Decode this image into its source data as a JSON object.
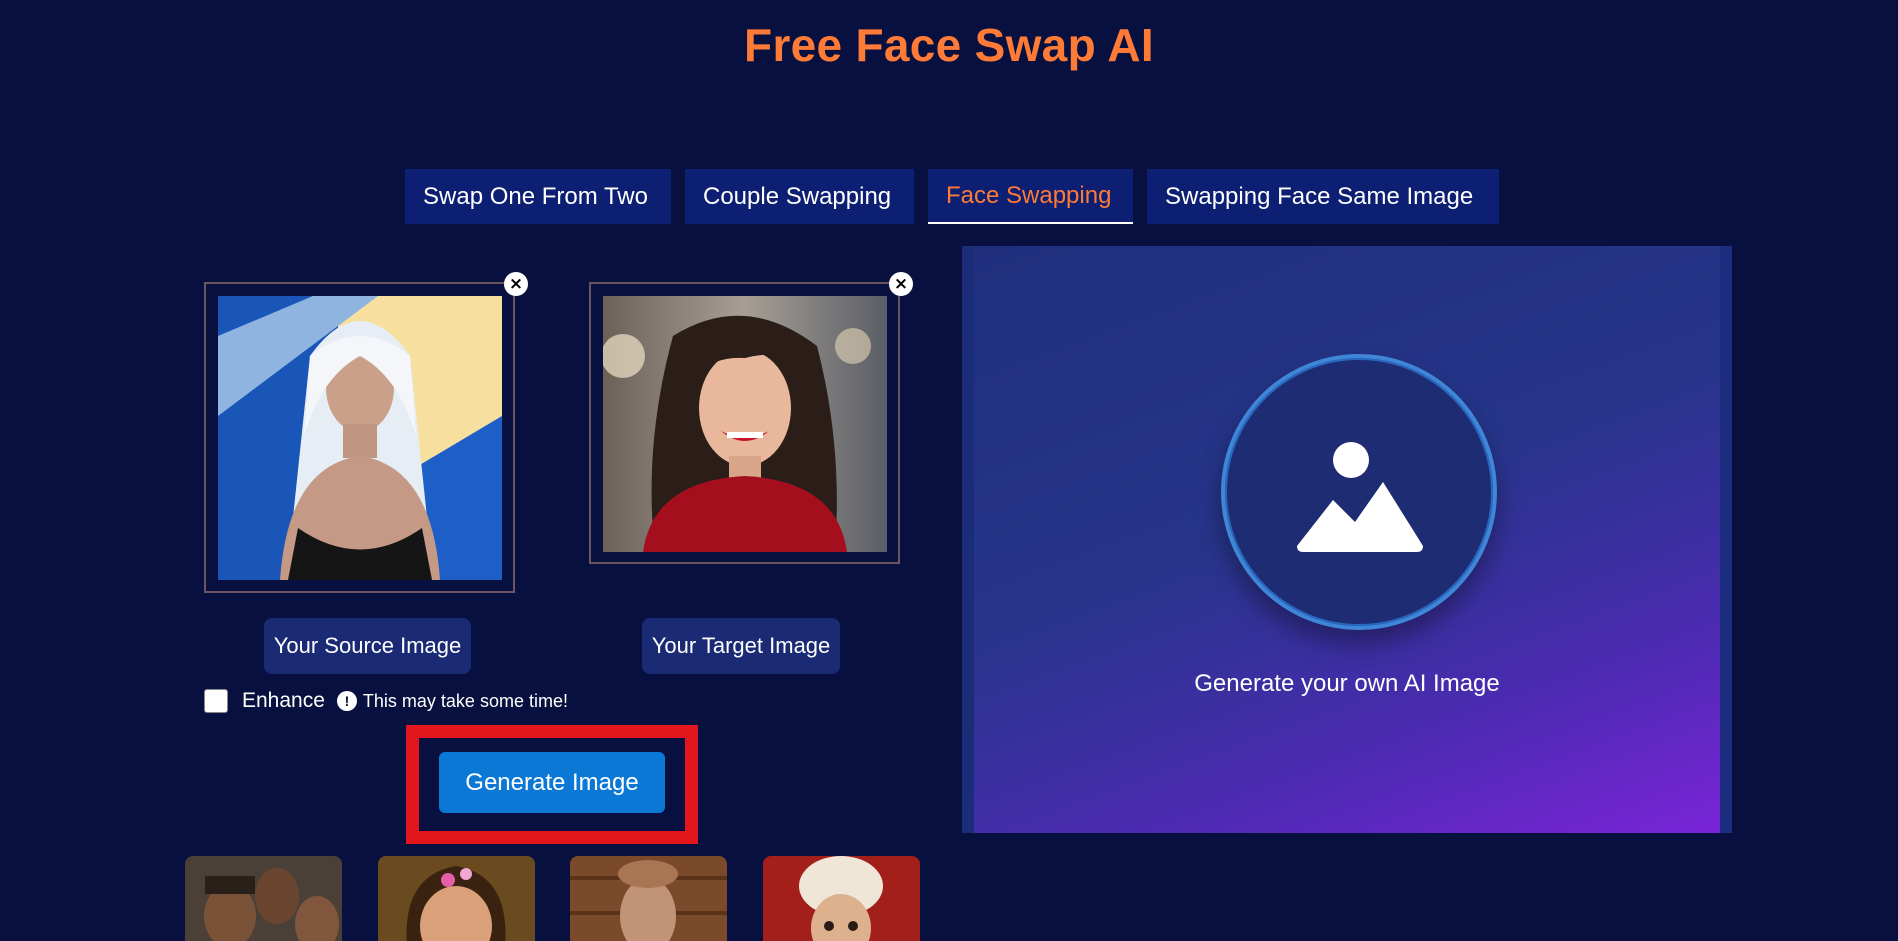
{
  "header": {
    "title": "Free Face Swap AI"
  },
  "tabs": [
    {
      "label": "Swap One From Two"
    },
    {
      "label": "Couple Swapping"
    },
    {
      "label": "Face Swapping",
      "active": true
    },
    {
      "label": "Swapping Face Same Image"
    }
  ],
  "source": {
    "label": "Your Source Image",
    "close_icon": "×"
  },
  "target": {
    "label": "Your Target Image",
    "close_icon": "×"
  },
  "options": {
    "enhance_label": "Enhance",
    "enhance_checked": false,
    "info_icon": "!",
    "warning_text": "This may take some time!"
  },
  "actions": {
    "generate_label": "Generate Image"
  },
  "result": {
    "placeholder_text": "Generate your own AI Image",
    "icon": "image-placeholder-icon"
  },
  "colors": {
    "title": "#fe7a37",
    "background": "#08103f",
    "tab_bg": "#0c1f72",
    "active_tab_text": "#fe7a37",
    "generate_button": "#0a78d4",
    "highlight": "#e3161e"
  }
}
